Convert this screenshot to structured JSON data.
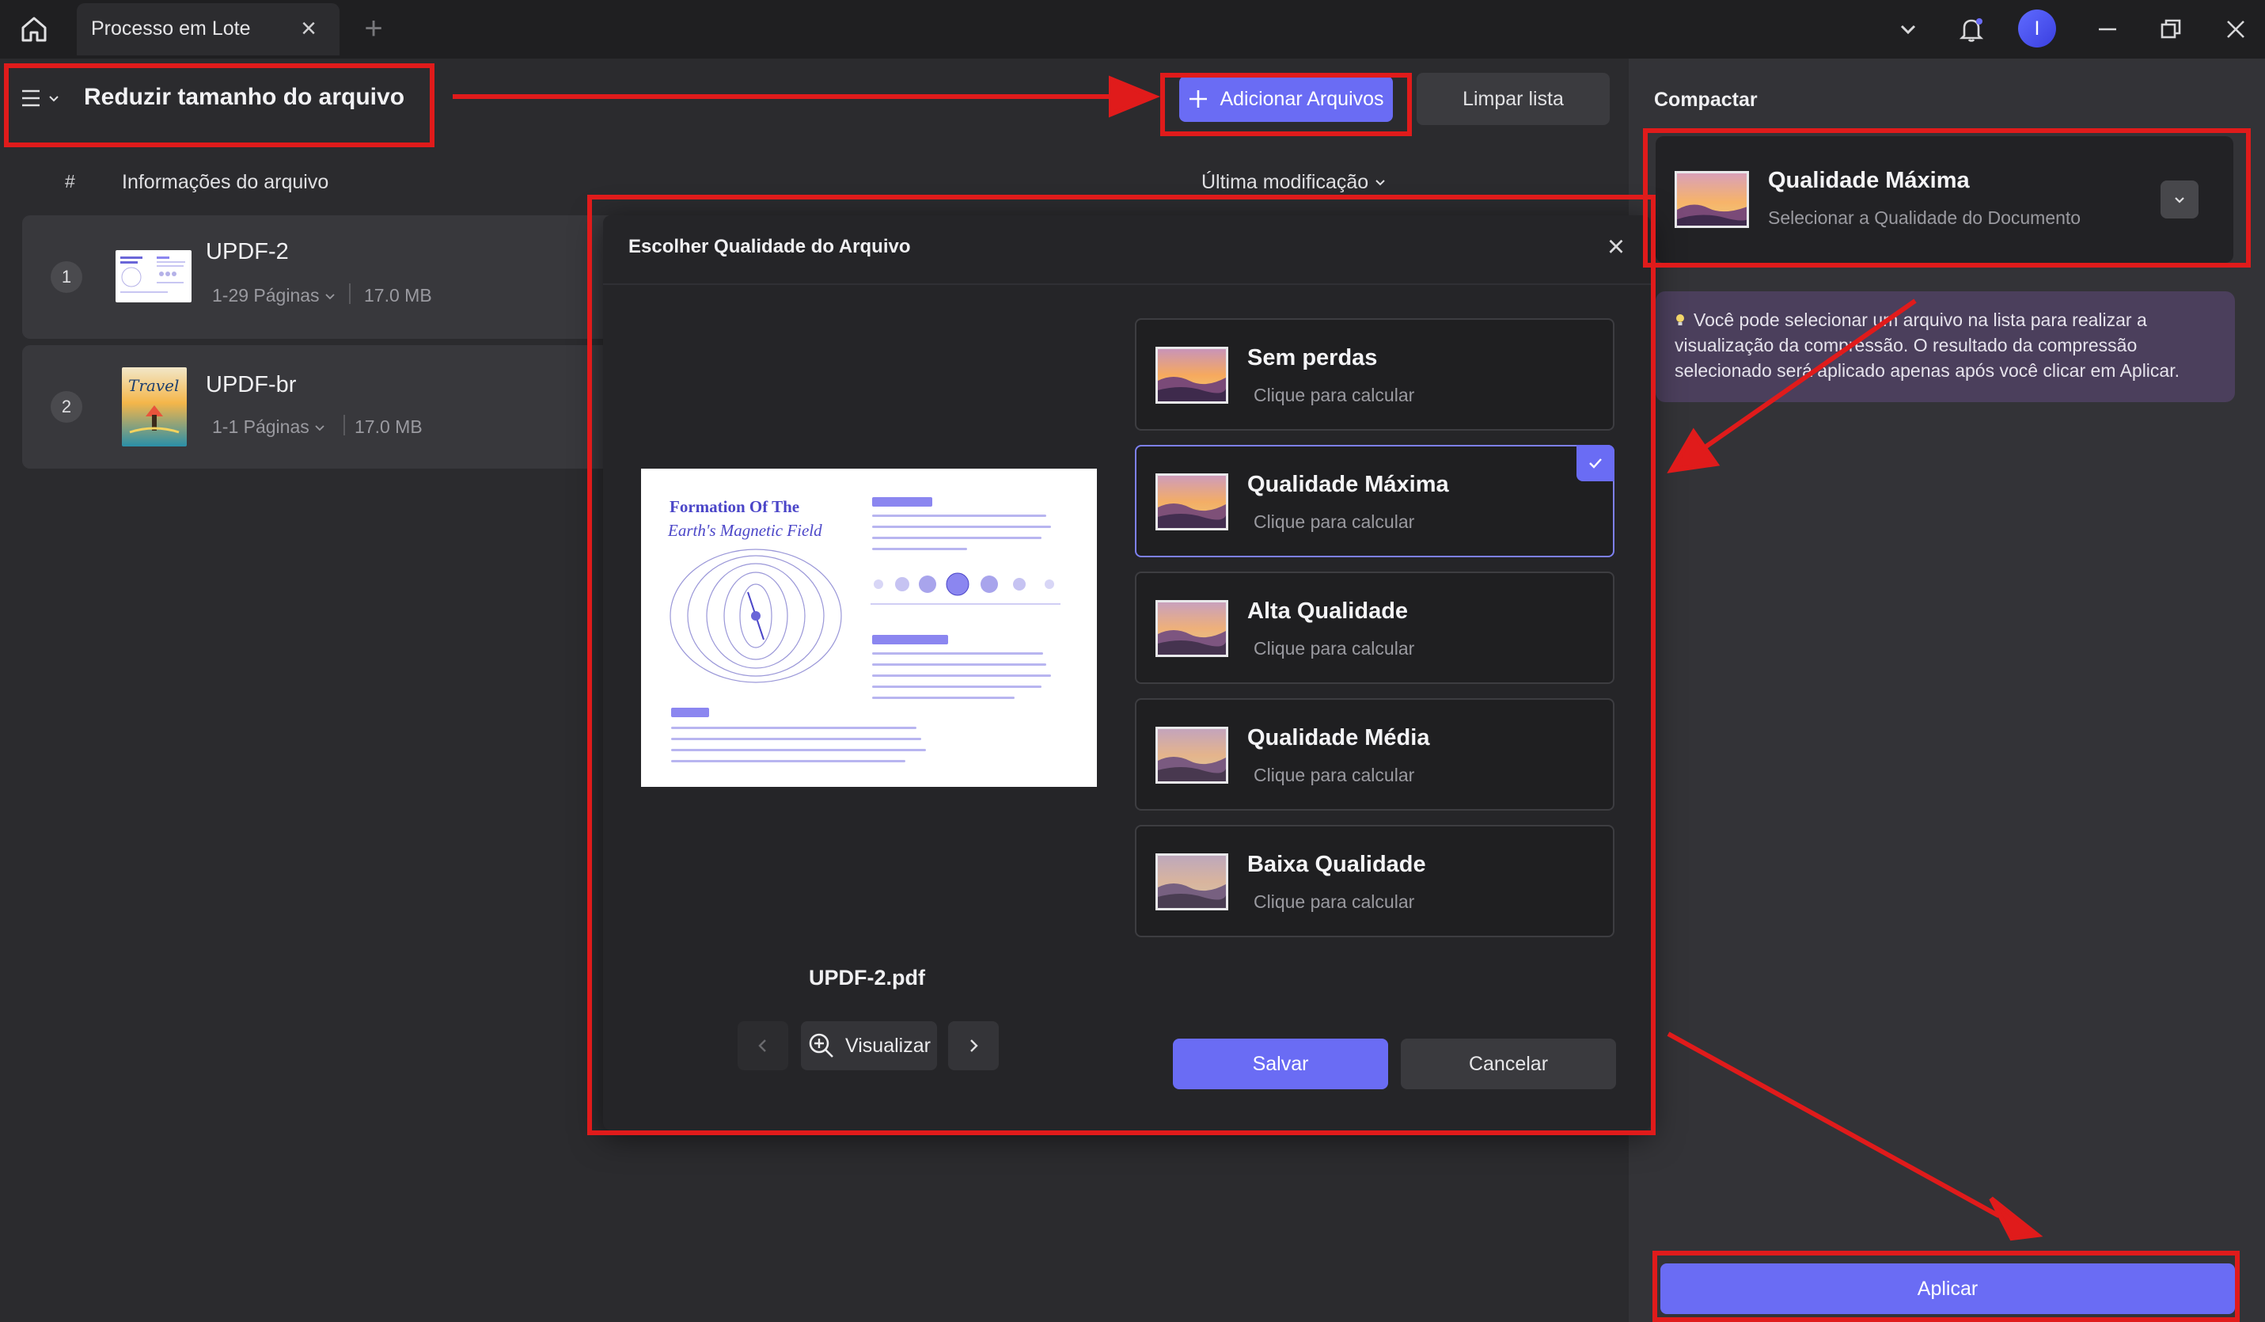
{
  "titlebar": {
    "tab_label": "Processo em Lote",
    "tab_close": "×",
    "tab_add": "+",
    "avatar_initial": "I"
  },
  "toolbar": {
    "title": "Reduzir tamanho do arquivo",
    "add_files": "Adicionar Arquivos",
    "clear_list": "Limpar lista"
  },
  "file_list": {
    "col_index": "#",
    "col_info": "Informações do arquivo",
    "col_modified": "Última modificação",
    "rows": [
      {
        "index": "1",
        "name": "UPDF-2",
        "pages": "1-29 Páginas",
        "size": "17.0 MB"
      },
      {
        "index": "2",
        "name": "UPDF-br",
        "pages": "1-1 Páginas",
        "size": "17.0 MB"
      }
    ]
  },
  "right_panel": {
    "title": "Compactar",
    "quality_title": "Qualidade Máxima",
    "quality_sub": "Selecionar a Qualidade do Documento",
    "tip": "Você pode selecionar um arquivo na lista para realizar a visualização da compressão. O resultado da compressão selecionado será aplicado apenas após você clicar em Aplicar.",
    "apply": "Aplicar"
  },
  "dialog": {
    "title": "Escolher Qualidade do Arquivo",
    "close": "×",
    "file_name": "UPDF-2.pdf",
    "preview_label": "Visualizar",
    "save": "Salvar",
    "cancel": "Cancelar",
    "selected_option": "Qualidade Máxima",
    "options": [
      {
        "title": "Sem perdas",
        "sub": "Clique para calcular"
      },
      {
        "title": "Qualidade Máxima",
        "sub": "Clique para calcular"
      },
      {
        "title": "Alta Qualidade",
        "sub": "Clique para calcular"
      },
      {
        "title": "Qualidade Média",
        "sub": "Clique para calcular"
      },
      {
        "title": "Baixa Qualidade",
        "sub": "Clique para calcular"
      }
    ],
    "doc_preview": {
      "title_line1": "Formation Of The",
      "title_line2": "Earth's Magnetic Field"
    }
  },
  "colors": {
    "accent": "#6a6cf4",
    "annotation_red": "#e01b1b",
    "dialog_bg": "#252528",
    "app_bg": "#2b2b2e"
  },
  "icons": [
    "home-icon",
    "chevron-down-icon",
    "bell-icon",
    "minimize-icon",
    "restore-icon",
    "close-icon",
    "hamburger-menu-icon",
    "plus-icon",
    "magnify-plus-icon",
    "chevron-left-icon",
    "chevron-right-icon",
    "check-icon",
    "lightbulb-icon"
  ]
}
